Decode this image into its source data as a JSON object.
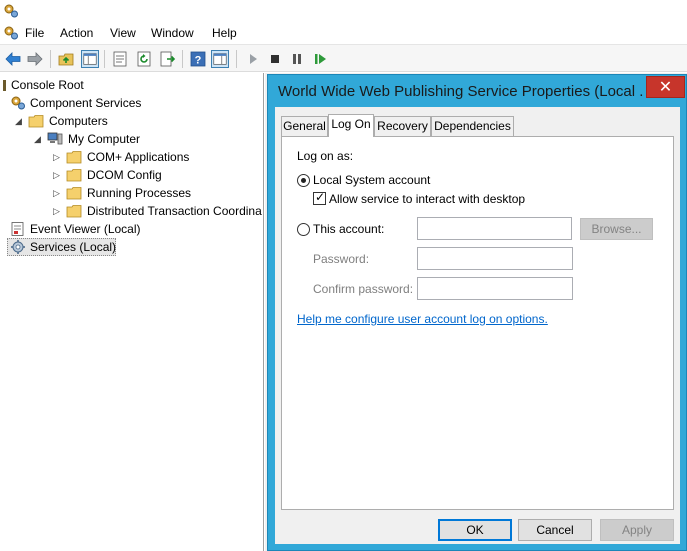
{
  "menu": {
    "items": [
      "File",
      "Action",
      "View",
      "Window",
      "Help"
    ]
  },
  "toolbar": {
    "buttons": [
      "back-icon",
      "forward-icon",
      "up-folder-icon",
      "show-hide-tree-icon",
      "properties-icon",
      "refresh-icon",
      "export-list-icon",
      "help-icon",
      "action-pane-icon",
      "start-icon",
      "stop-icon",
      "pause-icon",
      "restart-icon"
    ]
  },
  "tree": {
    "root": "Console Root",
    "component_services": "Component Services",
    "computers": "Computers",
    "my_computer": "My Computer",
    "children": [
      "COM+ Applications",
      "DCOM Config",
      "Running Processes",
      "Distributed Transaction Coordina"
    ],
    "event_viewer": "Event Viewer (Local)",
    "services": "Services (Local)"
  },
  "dialog": {
    "title": "World Wide Web Publishing Service Properties (Local ...",
    "close_glyph": "✕",
    "tabs": [
      "General",
      "Log On",
      "Recovery",
      "Dependencies"
    ],
    "active_tab": "Log On",
    "logon_as_label": "Log on as:",
    "local_system_label": "Local System account",
    "local_system_checked": true,
    "interact_label": "Allow service to interact with desktop",
    "interact_checked": true,
    "this_account_label": "This account:",
    "account_value": "",
    "browse_label": "Browse...",
    "password_label": "Password:",
    "password_value": "",
    "confirm_label": "Confirm password:",
    "confirm_value": "",
    "help_link": "Help me configure user account log on options.",
    "ok_label": "OK",
    "cancel_label": "Cancel",
    "apply_label": "Apply"
  },
  "colors": {
    "dialog_frame": "#31a8d8",
    "close_button": "#c7352b",
    "link": "#0066cc"
  }
}
